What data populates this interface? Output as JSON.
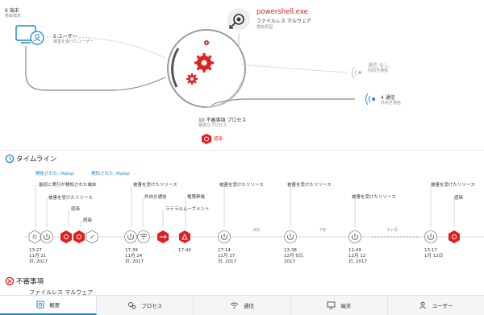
{
  "diagram": {
    "endpoints": {
      "count_label": "6 端末",
      "sub_label": "感染端末"
    },
    "users": {
      "count_label": "5 ユーザー",
      "sub_label": "被害を受けたユーザー"
    },
    "root_process": {
      "name": "powershell.exe",
      "type_label": "ファイルレス マルウェア",
      "sub_label": "根本原因"
    },
    "no_comm": {
      "label": "通信 なし",
      "sub_label": "内向き通信"
    },
    "comm": {
      "label": "4 通信",
      "sub_label": "外向き通信"
    },
    "suspicious": {
      "label": "10 不審事項 プロセス",
      "sub_label": "悪質なプロセス"
    },
    "infection": {
      "label": "感染"
    },
    "colors": {
      "accent": "#1e88c8",
      "danger": "#e02020",
      "gray": "#8a8a8a"
    }
  },
  "timeline": {
    "title": "タイムライン",
    "opened_malop": "開始された: Malop",
    "detected_malop": "検知された: Malop",
    "labels": [
      "最初に実行が検知された端末",
      "被害を受けたリソース",
      "感染",
      "感染",
      "被害を受けたリソース",
      "外向き通信",
      "権限昇格",
      "ラテラルムーブメント",
      "被害を受けたリソース",
      "被害を受けたリソース",
      "被害を受けたリソース",
      "被害を受けたリソース",
      "感染"
    ],
    "gaps": [
      "8日",
      "7日",
      "1ヶ月"
    ],
    "dates": [
      {
        "time": "13:27",
        "day": "11月 21",
        "year": "日, 2017"
      },
      {
        "time": "17:39",
        "day": "11月 24",
        "year": "日, 2017"
      },
      {
        "time": "17:40",
        "day": "",
        "year": ""
      },
      {
        "time": "17:14",
        "day": "11月 27",
        "year": "日, 2017"
      },
      {
        "time": "13:38",
        "day": "12月 5日,",
        "year": "2017"
      },
      {
        "time": "11:49",
        "day": "12月 12",
        "year": "日, 2017"
      },
      {
        "time": "13:17",
        "day": "1月 12日",
        "year": ""
      }
    ]
  },
  "suspicious_section": {
    "title": "不審事項",
    "cut_off_text": "ファイルレス マルウェア"
  },
  "tabs": [
    {
      "label": "概要",
      "icon": "gear-icon",
      "active": true
    },
    {
      "label": "プロセス",
      "icon": "gears-icon",
      "active": false
    },
    {
      "label": "通信",
      "icon": "wifi-icon",
      "active": false
    },
    {
      "label": "端末",
      "icon": "monitor-icon",
      "active": false
    },
    {
      "label": "ユーザー",
      "icon": "user-icon",
      "active": false
    }
  ]
}
